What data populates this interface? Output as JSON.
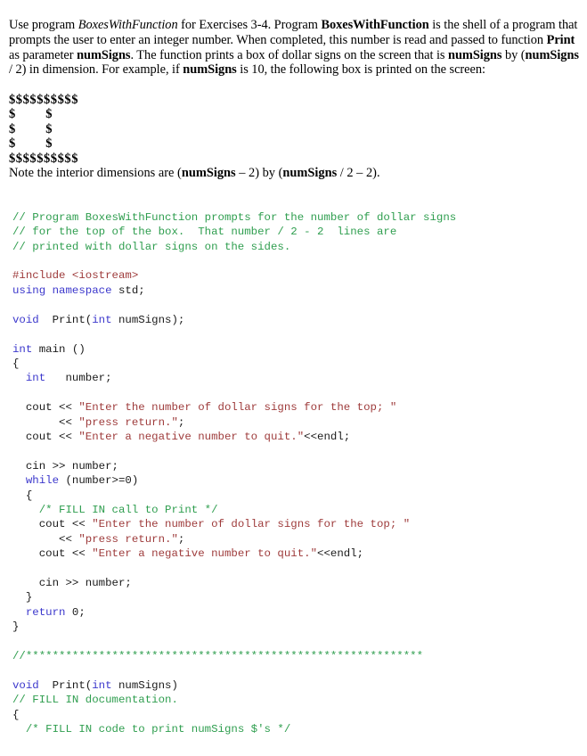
{
  "document": {
    "intro_paragraph": {
      "segments": [
        {
          "text": "Use program ",
          "style": "normal"
        },
        {
          "text": "BoxesWithFunction",
          "style": "italic"
        },
        {
          "text": " for Exercises 3-4.  Program ",
          "style": "normal"
        },
        {
          "text": "BoxesWithFunction",
          "style": "bold"
        },
        {
          "text": " is the shell of a program that prompts the user to enter an integer number. When completed, this number is read and passed to function ",
          "style": "normal"
        },
        {
          "text": "Print",
          "style": "bold"
        },
        {
          "text": " as parameter ",
          "style": "normal"
        },
        {
          "text": "numSigns",
          "style": "bold"
        },
        {
          "text": ". The function prints a box of dollar signs on the screen that is ",
          "style": "normal"
        },
        {
          "text": "numSigns",
          "style": "bold"
        },
        {
          "text": " by (",
          "style": "normal"
        },
        {
          "text": "numSigns",
          "style": "bold"
        },
        {
          "text": " / 2) in dimension. For example, if ",
          "style": "normal"
        },
        {
          "text": "numSigns",
          "style": "bold"
        },
        {
          "text": " is 10, the following box is printed on the screen:",
          "style": "normal"
        }
      ]
    },
    "sign_box": {
      "lines": [
        "$$$$$$$$$$",
        "$        $",
        "$        $",
        "$        $",
        "$$$$$$$$$$"
      ]
    },
    "note_line": {
      "segments": [
        {
          "text": "Note the interior dimensions are (",
          "style": "normal"
        },
        {
          "text": "numSigns",
          "style": "bold"
        },
        {
          "text": " – 2)  by (",
          "style": "normal"
        },
        {
          "text": "numSigns",
          "style": "bold"
        },
        {
          "text": " / 2 – 2).",
          "style": "normal"
        }
      ]
    },
    "code_listing": {
      "language": "cpp",
      "colors": {
        "comment": "#2f9e4f",
        "keyword": "#3b37cc",
        "string": "#9e3b3b",
        "preprocessor": "#9e3b3b",
        "plain": "#1a1a1a"
      },
      "lines": [
        [
          {
            "t": "// Program BoxesWithFunction prompts for the number of dollar signs",
            "c": "cmt"
          }
        ],
        [
          {
            "t": "// for the top of the box.  That number / 2 - 2  lines are",
            "c": "cmt"
          }
        ],
        [
          {
            "t": "// printed with dollar signs on the sides.",
            "c": "cmt"
          }
        ],
        [],
        [
          {
            "t": "#include <iostream>",
            "c": "pre"
          }
        ],
        [
          {
            "t": "using namespace",
            "c": "kw"
          },
          {
            "t": " std;",
            "c": "pln"
          }
        ],
        [],
        [
          {
            "t": "void",
            "c": "kw"
          },
          {
            "t": "  Print(",
            "c": "pln"
          },
          {
            "t": "int",
            "c": "kw"
          },
          {
            "t": " numSigns);",
            "c": "pln"
          }
        ],
        [],
        [
          {
            "t": "int",
            "c": "kw"
          },
          {
            "t": " main ()",
            "c": "pln"
          }
        ],
        [
          {
            "t": "{",
            "c": "pln"
          }
        ],
        [
          {
            "t": "  ",
            "c": "pln"
          },
          {
            "t": "int",
            "c": "kw"
          },
          {
            "t": "   number;",
            "c": "pln"
          }
        ],
        [],
        [
          {
            "t": "  cout << ",
            "c": "pln"
          },
          {
            "t": "\"Enter the number of dollar signs for the top; \"",
            "c": "str"
          }
        ],
        [
          {
            "t": "       << ",
            "c": "pln"
          },
          {
            "t": "\"press return.\"",
            "c": "str"
          },
          {
            "t": ";",
            "c": "pln"
          }
        ],
        [
          {
            "t": "  cout << ",
            "c": "pln"
          },
          {
            "t": "\"Enter a negative number to quit.\"",
            "c": "str"
          },
          {
            "t": "<<endl;",
            "c": "pln"
          }
        ],
        [],
        [
          {
            "t": "  cin >> number;",
            "c": "pln"
          }
        ],
        [
          {
            "t": "  ",
            "c": "pln"
          },
          {
            "t": "while",
            "c": "kw"
          },
          {
            "t": " (number>=0)",
            "c": "pln"
          }
        ],
        [
          {
            "t": "  {",
            "c": "pln"
          }
        ],
        [
          {
            "t": "    ",
            "c": "pln"
          },
          {
            "t": "/* FILL IN call to Print */",
            "c": "cmt"
          }
        ],
        [
          {
            "t": "    cout << ",
            "c": "pln"
          },
          {
            "t": "\"Enter the number of dollar signs for the top; \"",
            "c": "str"
          }
        ],
        [
          {
            "t": "       << ",
            "c": "pln"
          },
          {
            "t": "\"press return.\"",
            "c": "str"
          },
          {
            "t": ";",
            "c": "pln"
          }
        ],
        [
          {
            "t": "    cout << ",
            "c": "pln"
          },
          {
            "t": "\"Enter a negative number to quit.\"",
            "c": "str"
          },
          {
            "t": "<<endl;",
            "c": "pln"
          }
        ],
        [],
        [
          {
            "t": "    cin >> number;",
            "c": "pln"
          }
        ],
        [
          {
            "t": "  }",
            "c": "pln"
          }
        ],
        [
          {
            "t": "  ",
            "c": "pln"
          },
          {
            "t": "return",
            "c": "kw"
          },
          {
            "t": " 0;",
            "c": "pln"
          }
        ],
        [
          {
            "t": "}",
            "c": "pln"
          }
        ],
        [],
        [
          {
            "t": "//************************************************************",
            "c": "cmt"
          }
        ],
        [],
        [
          {
            "t": "void",
            "c": "kw"
          },
          {
            "t": "  Print(",
            "c": "pln"
          },
          {
            "t": "int",
            "c": "kw"
          },
          {
            "t": " numSigns)",
            "c": "pln"
          }
        ],
        [
          {
            "t": "// FILL IN documentation.",
            "c": "cmt"
          }
        ],
        [
          {
            "t": "{",
            "c": "pln"
          }
        ],
        [
          {
            "t": "  ",
            "c": "pln"
          },
          {
            "t": "/* FILL IN code to print numSigns $'s */",
            "c": "cmt"
          }
        ]
      ]
    }
  }
}
